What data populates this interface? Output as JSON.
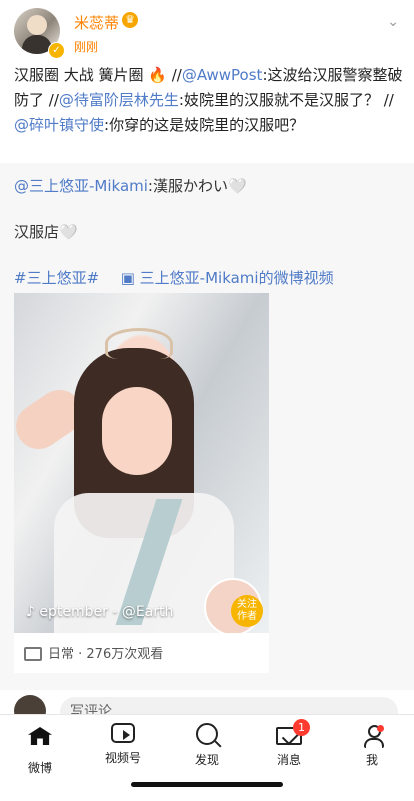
{
  "post": {
    "username": "米蕊蒂",
    "time": "刚刚",
    "text_parts": [
      {
        "text": "汉服圈 大战 簧片圈 🔥 //",
        "link": false
      },
      {
        "text": "@AwwPost",
        "link": true
      },
      {
        "text": ":这波给汉服警察整破防了 //",
        "link": false
      },
      {
        "text": "@待富阶层林先生",
        "link": true
      },
      {
        "text": ":妓院里的汉服就不是汉服了？ //",
        "link": false
      },
      {
        "text": "@碎叶镇守使",
        "link": true
      },
      {
        "text": ":你穿的这是妓院里的汉服吧？",
        "link": false
      }
    ]
  },
  "repost": {
    "author": "@三上悠亚-Mikami",
    "author_text": ":漢服かわい🤍",
    "line2": "汉服店🤍",
    "topic": "#三上悠亚#",
    "video_link": "三上悠亚-Mikami的微博视频",
    "music": "♪ eptember - @Earth",
    "follow": "关注\n作者",
    "meta": "日常 · 276万次观看"
  },
  "comment": {
    "placeholder": "写评论"
  },
  "tabs": [
    {
      "label": "微博"
    },
    {
      "label": "视频号"
    },
    {
      "label": "发现"
    },
    {
      "label": "消息"
    },
    {
      "label": "我"
    }
  ],
  "badges": {
    "messages": "1"
  },
  "colors": {
    "accent_orange": "#ff8200",
    "link_blue": "#4f7bc7",
    "badge_red": "#ff3b30"
  }
}
